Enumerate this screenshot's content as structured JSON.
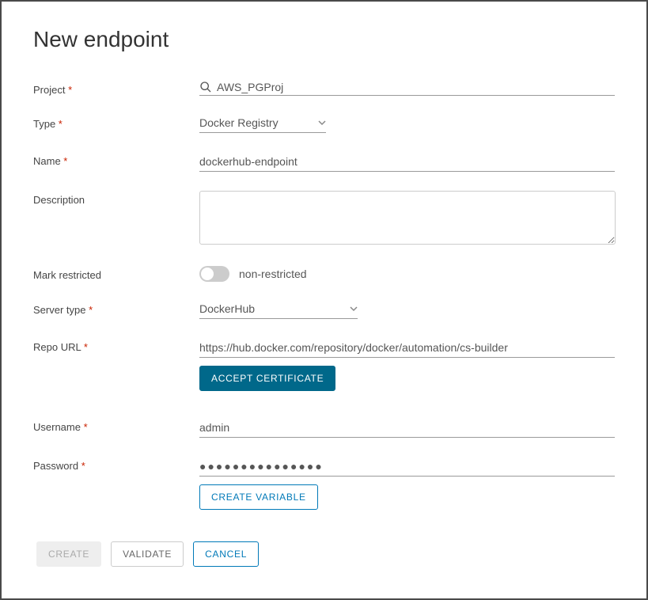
{
  "title": "New endpoint",
  "labels": {
    "project": "Project",
    "type": "Type",
    "name": "Name",
    "description": "Description",
    "restricted": "Mark restricted",
    "server_type": "Server type",
    "repo_url": "Repo URL",
    "username": "Username",
    "password": "Password"
  },
  "fields": {
    "project": "AWS_PGProj",
    "type": "Docker Registry",
    "name": "dockerhub-endpoint",
    "description": "",
    "restricted_label": "non-restricted",
    "server_type": "DockerHub",
    "repo_url": "https://hub.docker.com/repository/docker/automation/cs-builder",
    "username": "admin",
    "password_masked": "●●●●●●●●●●●●●●●"
  },
  "buttons": {
    "accept_cert": "Accept Certificate",
    "create_variable": "Create Variable",
    "create": "Create",
    "validate": "Validate",
    "cancel": "Cancel"
  }
}
